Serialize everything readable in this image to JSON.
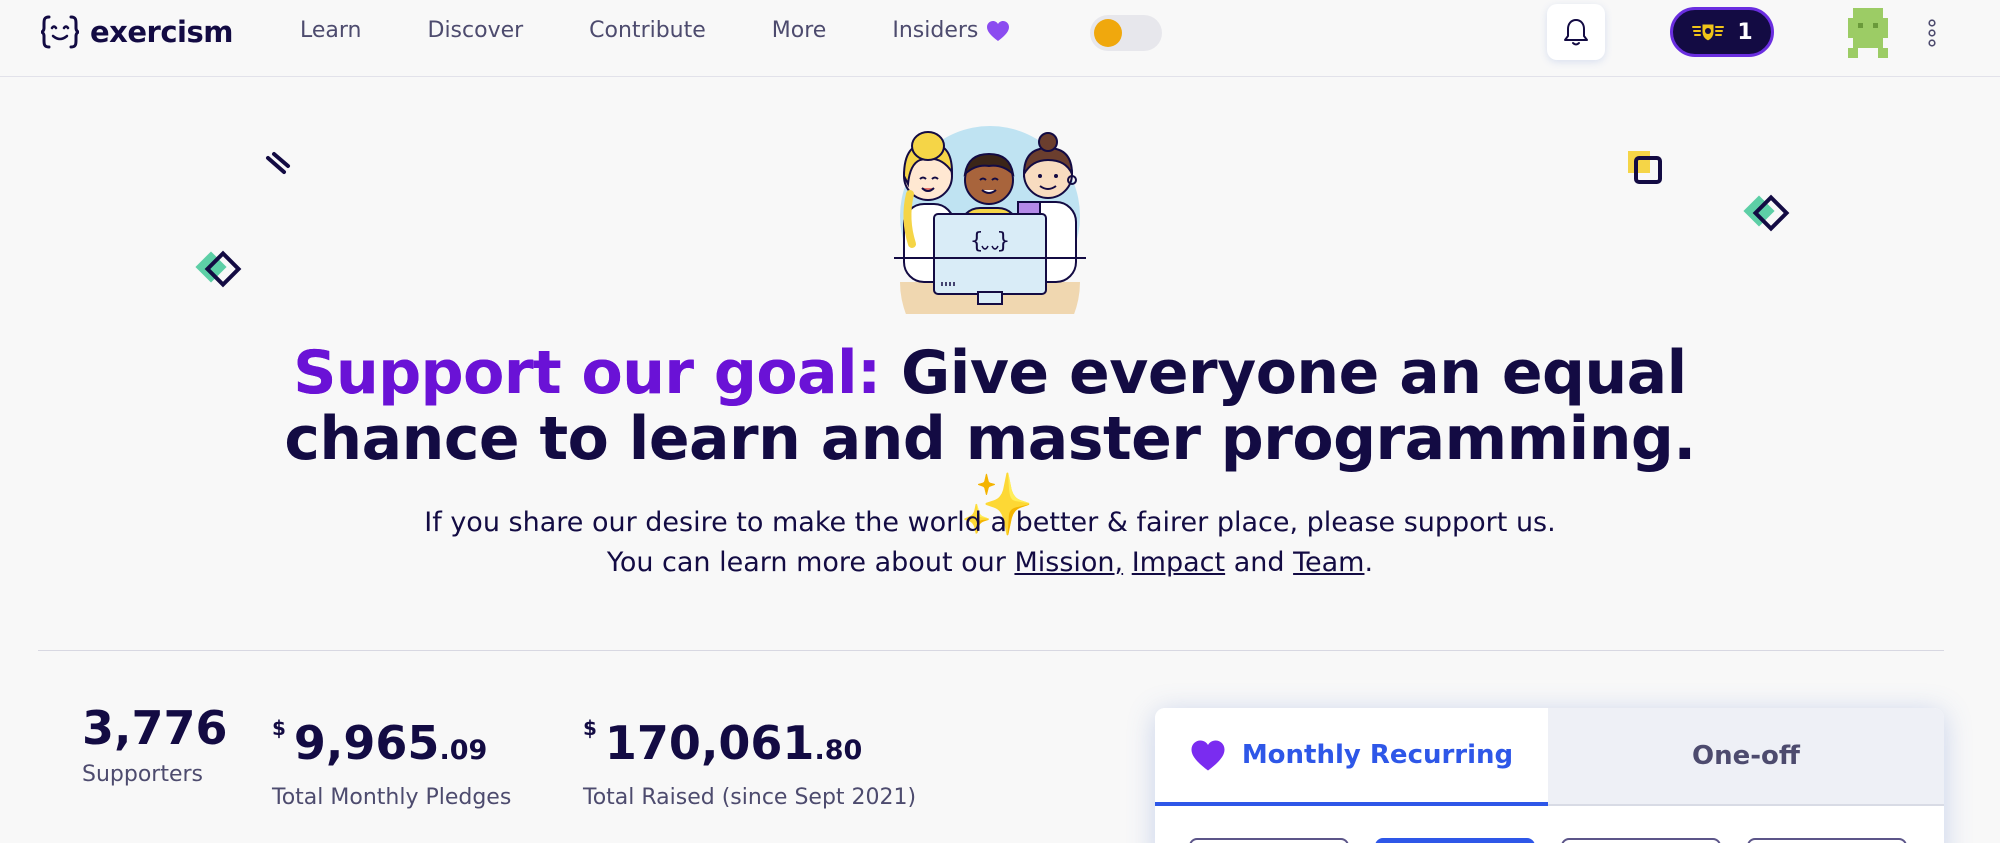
{
  "brand": {
    "name": "exercism"
  },
  "nav": {
    "learn": "Learn",
    "discover": "Discover",
    "contribute": "Contribute",
    "more": "More",
    "insiders": "Insiders"
  },
  "header": {
    "reputation": "1"
  },
  "hero": {
    "headline_accent": "Support our goal:",
    "headline_rest_1": "Give everyone an equal",
    "headline_rest_2": "chance to learn and master programming.",
    "sparkle": "✨",
    "sub_1": "If you share our desire to make the world a better & fairer place, please support us.",
    "sub_2_prefix": "You can learn more about our",
    "link_mission": "Mission",
    "link_impact": "Impact",
    "sub_2_and": "and",
    "link_team": "Team",
    "sub_2_end": "."
  },
  "stats": {
    "supporters_value": "3,776",
    "supporters_label": "Supporters",
    "monthly_currency": "$",
    "monthly_whole": "9,965",
    "monthly_cents": ".09",
    "monthly_label": "Total Monthly Pledges",
    "raised_currency": "$",
    "raised_whole": "170,061",
    "raised_cents": ".80",
    "raised_label": "Total Raised (since Sept 2021)"
  },
  "donate": {
    "tab_monthly": "Monthly Recurring",
    "tab_oneoff": "One-off"
  },
  "colors": {
    "accent_purple": "#6a12d6",
    "primary_blue": "#2e57e8",
    "navy": "#130b43"
  },
  "icons": [
    "logo-icon",
    "heart-icon",
    "bell-icon",
    "reputation-badge-icon",
    "avatar-icon",
    "more-dots-icon",
    "sparkle-icon"
  ]
}
